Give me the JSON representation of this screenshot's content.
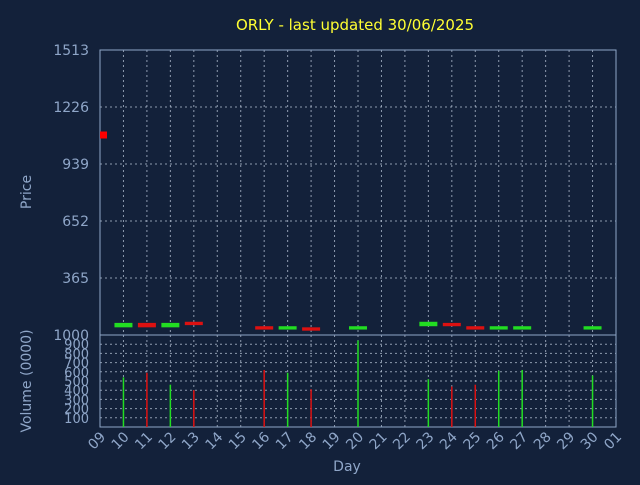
{
  "chart_data": {
    "type": "candlestick",
    "title": "ORLY - last updated 30/06/2025",
    "price_panel": {
      "ylabel": "Price",
      "ylim": [
        1000,
        1513
      ],
      "yticks": [
        1513,
        1226,
        939,
        652,
        365
      ],
      "x_first_label": "09",
      "last_price_marker": 1360
    },
    "volume_panel": {
      "ylabel": "Volume (0000)",
      "ylim": [
        0,
        1000
      ],
      "yticks": [
        1000,
        900,
        800,
        700,
        600,
        500,
        400,
        300,
        200,
        100
      ],
      "xlabel": "Day"
    },
    "x_ticks": [
      "09",
      "10",
      "11",
      "12",
      "13",
      "14",
      "15",
      "16",
      "17",
      "18",
      "19",
      "20",
      "21",
      "22",
      "23",
      "24",
      "25",
      "26",
      "27",
      "28",
      "29",
      "30",
      "01"
    ],
    "candles": [
      {
        "day": "10",
        "open": 1012,
        "close": 1020,
        "volume": 540,
        "up": true
      },
      {
        "day": "11",
        "open": 1020,
        "close": 1012,
        "volume": 590,
        "up": false
      },
      {
        "day": "12",
        "open": 1012,
        "close": 1020,
        "volume": 460,
        "up": true
      },
      {
        "day": "13",
        "open": 1022,
        "close": 1016,
        "volume": 400,
        "up": false
      },
      {
        "day": "16",
        "open": 1014,
        "close": 1008,
        "volume": 620,
        "up": false
      },
      {
        "day": "17",
        "open": 1008,
        "close": 1014,
        "volume": 590,
        "up": true
      },
      {
        "day": "18",
        "open": 1012,
        "close": 1006,
        "volume": 410,
        "up": false
      },
      {
        "day": "20",
        "open": 1008,
        "close": 1014,
        "volume": 940,
        "up": true
      },
      {
        "day": "23",
        "open": 1014,
        "close": 1022,
        "volume": 520,
        "up": true
      },
      {
        "day": "24",
        "open": 1020,
        "close": 1014,
        "volume": 440,
        "up": false
      },
      {
        "day": "25",
        "open": 1014,
        "close": 1008,
        "volume": 460,
        "up": false
      },
      {
        "day": "26",
        "open": 1008,
        "close": 1014,
        "volume": 610,
        "up": true
      },
      {
        "day": "27",
        "open": 1008,
        "close": 1014,
        "volume": 620,
        "up": true
      },
      {
        "day": "30",
        "open": 1008,
        "close": 1014,
        "volume": 560,
        "up": true
      }
    ],
    "colors": {
      "up": "#22dd22",
      "down": "#dd1111",
      "marker": "#ff0000"
    }
  }
}
